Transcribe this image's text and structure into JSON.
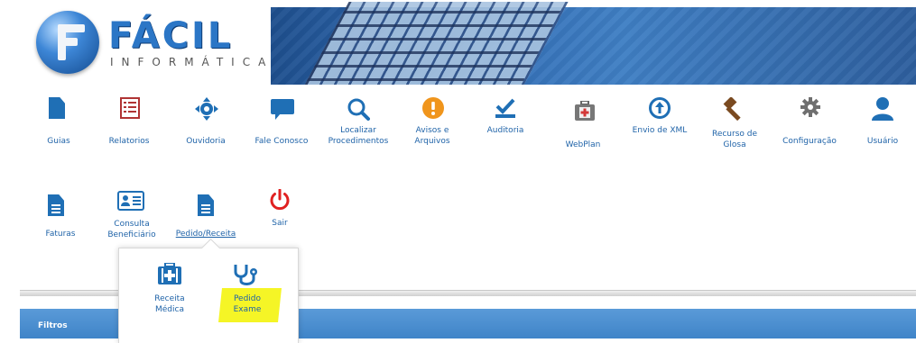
{
  "logo": {
    "title": "FÁCIL",
    "subtitle": "INFORMÁTICA"
  },
  "menu_row1": [
    {
      "label": "Guias",
      "icon": "document-icon"
    },
    {
      "label": "Relatorios",
      "icon": "report-icon"
    },
    {
      "label": "Ouvidoria",
      "icon": "move-icon"
    },
    {
      "label": "Fale Conosco",
      "icon": "chat-icon"
    },
    {
      "label": "Localizar Procedimentos",
      "line1": "Localizar",
      "line2": "Procedimentos",
      "icon": "search-icon"
    },
    {
      "label": "Avisos e Arquivos",
      "line1": "Avisos e",
      "line2": "Arquivos",
      "icon": "alert-icon"
    },
    {
      "label": "Auditoria",
      "icon": "checkmark-icon"
    },
    {
      "label": "WebPlan",
      "icon": "medical-kit-icon"
    },
    {
      "label": "Envio de XML",
      "icon": "upload-icon"
    },
    {
      "label": "Recurso de Glosa",
      "line1": "Recurso de",
      "line2": "Glosa",
      "icon": "gavel-icon"
    },
    {
      "label": "Configuração",
      "icon": "gear-icon"
    },
    {
      "label": "Usuário",
      "icon": "user-icon"
    }
  ],
  "menu_row2": [
    {
      "label": "Faturas",
      "icon": "document-icon"
    },
    {
      "label": "Consulta Beneficiário",
      "line1": "Consulta",
      "line2": "Beneficiário",
      "icon": "id-card-icon"
    },
    {
      "label": "Pedido/Receita",
      "icon": "document-icon"
    },
    {
      "label": "Sair",
      "icon": "power-icon"
    }
  ],
  "popup": [
    {
      "label": "Receita Médica",
      "line1": "Receita",
      "line2": "Médica",
      "icon": "medical-case-icon"
    },
    {
      "label": "Pedido Exame",
      "line1": "Pedido",
      "line2": "Exame",
      "icon": "stethoscope-icon"
    }
  ],
  "filters": {
    "label": "Filtros"
  },
  "colors": {
    "accent": "#1f6fb5",
    "report_red": "#b03434",
    "alert_orange": "#f0951c",
    "power_red": "#e02020",
    "highlight": "#f4f40e",
    "filters_bar": "#4a8cd0"
  }
}
